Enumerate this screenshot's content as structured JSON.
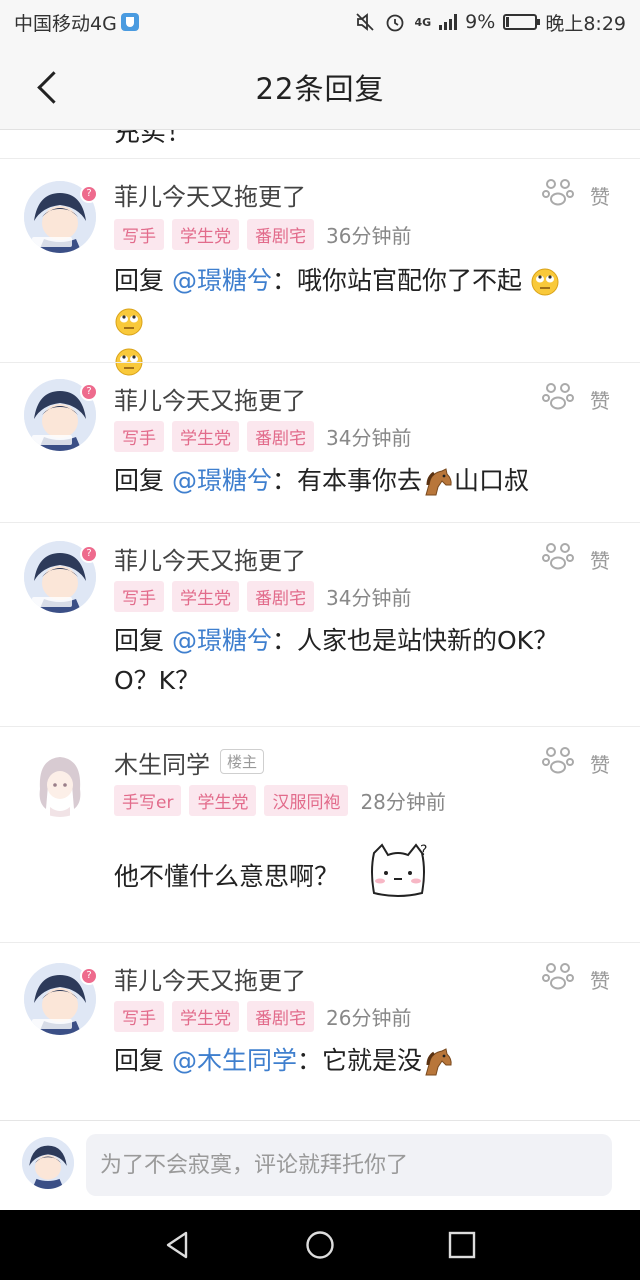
{
  "status_bar": {
    "carrier": "中国移动4G",
    "network": "4G",
    "battery": "9%",
    "battery_level": 0.09,
    "time": "晚上8:29"
  },
  "header": {
    "title": "22条回复",
    "back_icon": "chevron-left-icon"
  },
  "cut_text": "充实！",
  "like_label": "赞",
  "comments": [
    {
      "name": "菲儿今天又拖更了",
      "tags": [
        "写手",
        "学生党",
        "番剧宅"
      ],
      "time": "36分钟前",
      "reply_prefix": "回复",
      "mention": "@璟糖兮",
      "sep": "：",
      "text": "哦你站官配你了不起",
      "emojis": [
        "eye-roll-emoji",
        "eye-roll-emoji",
        "eye-roll-emoji"
      ]
    },
    {
      "name": "菲儿今天又拖更了",
      "tags": [
        "写手",
        "学生党",
        "番剧宅"
      ],
      "time": "34分钟前",
      "reply_prefix": "回复",
      "mention": "@璟糖兮",
      "sep": "：",
      "text_before": "有本事你去",
      "text_after": "山口叔",
      "emojis": [
        "horse-emoji"
      ]
    },
    {
      "name": "菲儿今天又拖更了",
      "tags": [
        "写手",
        "学生党",
        "番剧宅"
      ],
      "time": "34分钟前",
      "reply_prefix": "回复",
      "mention": "@璟糖兮",
      "sep": "：",
      "text_line1": "人家也是站快新的OK？",
      "text_line2": "O？K？"
    },
    {
      "name": "木生同学",
      "host_label": "楼主",
      "tags": [
        "手写er",
        "学生党",
        "汉服同袍"
      ],
      "time": "28分钟前",
      "text": "他不懂什么意思啊？",
      "sticker": "confused-cat-sticker"
    },
    {
      "name": "菲儿今天又拖更了",
      "tags": [
        "写手",
        "学生党",
        "番剧宅"
      ],
      "time": "26分钟前",
      "reply_prefix": "回复",
      "mention": "@木生同学",
      "sep": "：",
      "text_before": "它就是没",
      "emojis": [
        "horse-emoji"
      ]
    }
  ],
  "input": {
    "placeholder": "为了不会寂寞，评论就拜托你了"
  },
  "nav": {
    "back_icon": "triangle-back-icon",
    "home_icon": "circle-home-icon",
    "recent_icon": "square-recent-icon"
  }
}
